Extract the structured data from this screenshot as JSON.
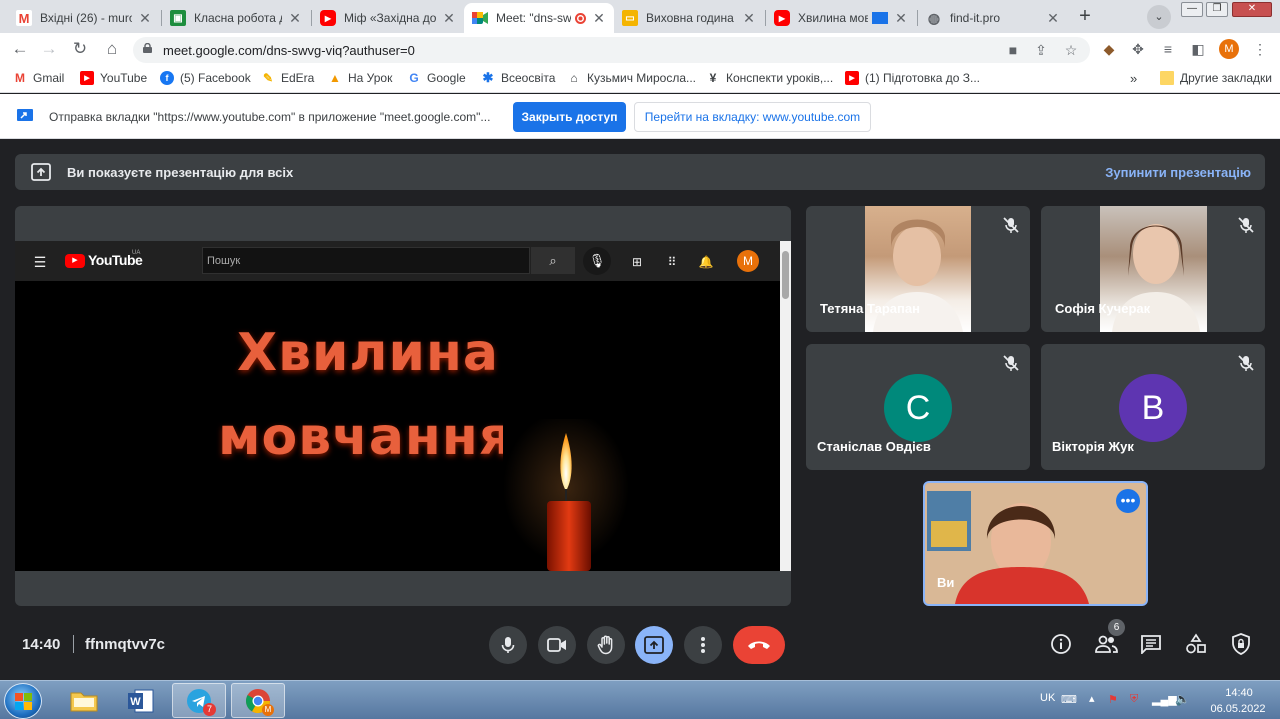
{
  "browser": {
    "tabs": [
      {
        "title": "Вхідні (26) - murov",
        "icon": "gmail-icon",
        "color": "#ea4335"
      },
      {
        "title": "Класна робота для",
        "icon": "classroom-icon",
        "color": "#1e8e3e"
      },
      {
        "title": "Міф «Західна доп",
        "icon": "youtube-icon",
        "color": "#ff0000"
      },
      {
        "title": "Meet: \"dns-sw",
        "icon": "meet-icon",
        "color": "#00897b",
        "active": true
      },
      {
        "title": "Виховна година \"",
        "icon": "slides-icon",
        "color": "#f4b400"
      },
      {
        "title": "Хвилина мов",
        "icon": "youtube-icon",
        "color": "#ff0000"
      },
      {
        "title": "find-it.pro",
        "icon": "globe-icon",
        "color": "#5f6368"
      }
    ],
    "url": "meet.google.com/dns-swvg-viq?authuser=0",
    "profile_initial": "M",
    "bookmarks": [
      {
        "label": "Gmail",
        "color": "#ea4335"
      },
      {
        "label": "YouTube",
        "color": "#ff0000"
      },
      {
        "label": "(5) Facebook",
        "color": "#1877f2"
      },
      {
        "label": "EdEra",
        "color": "#f4b400"
      },
      {
        "label": "На Урок",
        "color": "#f29900"
      },
      {
        "label": "Google",
        "color": "#4285f4"
      },
      {
        "label": "Всеосвіта",
        "color": "#1a73e8"
      },
      {
        "label": "Кузьмич Миросла...",
        "color": "#3c4043"
      },
      {
        "label": "Конспекти уроків,...",
        "color": "#3c4043"
      },
      {
        "label": "(1) Підготовка до З...",
        "color": "#ff0000"
      }
    ],
    "bookmarks_more": "»",
    "other_bookmarks": "Другие закладки"
  },
  "infobar": {
    "message": "Отправка вкладки \"https://www.youtube.com\" в приложение \"meet.google.com\"...",
    "allow_label": "Закрыть доступ",
    "goto_label": "Перейти на вкладку: www.youtube.com"
  },
  "meet": {
    "present_banner": "Ви показуєте презентацію для всіх",
    "stop_presenting": "Зупинити презентацію",
    "youtube": {
      "logo": "YouTube",
      "region": "UA",
      "search_placeholder": "Пошук",
      "avatar": "M",
      "video_line_1": "Хвилина",
      "video_line_2": "мовчання"
    },
    "participants": [
      {
        "name": "Тетяна Тарапан",
        "type": "video",
        "muted": true
      },
      {
        "name": "Софія Кучерак",
        "type": "video",
        "muted": true
      },
      {
        "name": "Станіслав Овдієв",
        "type": "avatar",
        "initial": "C",
        "color": "#00897b",
        "muted": true
      },
      {
        "name": "Вікторія Жук",
        "type": "avatar",
        "initial": "B",
        "color": "#5e35b1",
        "muted": true
      }
    ],
    "self_name": "Ви",
    "clock": "14:40",
    "meeting_code": "ffnmqtvv7c",
    "people_count": "6"
  },
  "taskbar": {
    "language": "UK",
    "time": "14:40",
    "date": "06.05.2022",
    "telegram_badge": "7"
  }
}
